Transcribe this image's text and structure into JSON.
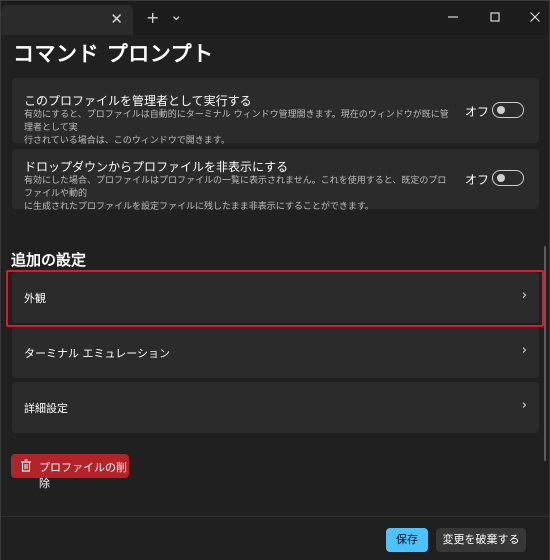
{
  "titlebar": {
    "tab_close": "✕",
    "new_tab": "+",
    "dropdown": "⌄"
  },
  "page": {
    "title": "コマンド プロンプト"
  },
  "settings": [
    {
      "title": "このプロファイルを管理者として実行する",
      "desc_lines": [
        "有効にすると、プロファイルは自動的にターミナル ウィンドウ管理開きます。現在のウィンドウが既に管理者として実",
        "行されている場合は、このウィンドウで開きます。"
      ],
      "toggle_label": "オフ",
      "toggle_on": false
    },
    {
      "title": "ドロップダウンからプロファイルを非表示にする",
      "desc_lines": [
        "有効にした場合、プロファイルはプロファイルの一覧に表示されません。これを使用すると、既定のプロファイルや動的",
        "に生成されたプロファイルを設定ファイルに残したまま非表示にすることができます。"
      ],
      "toggle_label": "オフ",
      "toggle_on": false
    }
  ],
  "additional": {
    "section_title": "追加の設定",
    "items": [
      {
        "label": "外観",
        "chevron": "›"
      },
      {
        "label": "ターミナル エミュレーション",
        "chevron": "›"
      },
      {
        "label": "詳細設定",
        "chevron": "›"
      }
    ]
  },
  "delete_button": {
    "label": "プロファイルの削除"
  },
  "footer": {
    "save_label": "保存",
    "discard_label": "変更を破棄する"
  },
  "colors": {
    "accent": "#4cc2ff",
    "danger": "#b4232a",
    "highlight": "#e0192a",
    "background": "#202020",
    "card": "#2b2b2b"
  }
}
